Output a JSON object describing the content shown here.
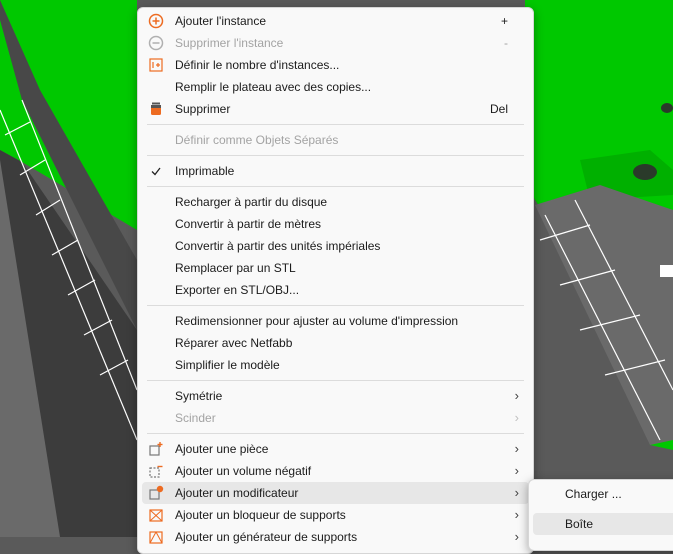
{
  "context_menu": {
    "add_instance": "Ajouter l'instance",
    "add_instance_shortcut": "+",
    "remove_instance": "Supprimer l'instance",
    "remove_instance_shortcut": "-",
    "set_instances": "Définir le nombre d'instances...",
    "fill_bed": "Remplir le plateau avec des copies...",
    "delete": "Supprimer",
    "delete_shortcut": "Del",
    "set_separate": "Définir comme Objets Séparés",
    "printable": "Imprimable",
    "reload": "Recharger à partir du disque",
    "convert_meters": "Convertir à partir de mètres",
    "convert_imperial": "Convertir à partir des unités impériales",
    "replace_stl": "Remplacer par un STL",
    "export_stl": "Exporter en STL/OBJ...",
    "resize_volume": "Redimensionner pour ajuster au volume d'impression",
    "repair_netfabb": "Réparer avec Netfabb",
    "simplify": "Simplifier le modèle",
    "mirror": "Symétrie",
    "split": "Scinder",
    "add_part": "Ajouter une pièce",
    "add_negative": "Ajouter un volume négatif",
    "add_modifier": "Ajouter un modificateur",
    "add_blocker": "Ajouter un bloqueur de supports",
    "add_enforcer": "Ajouter un générateur de supports"
  },
  "submenu": {
    "load": "Charger ...",
    "box": "Boîte"
  },
  "colors": {
    "object_green": "#00c800",
    "accent_orange": "#ed6b21",
    "bed_gray": "#5a5a5a"
  }
}
